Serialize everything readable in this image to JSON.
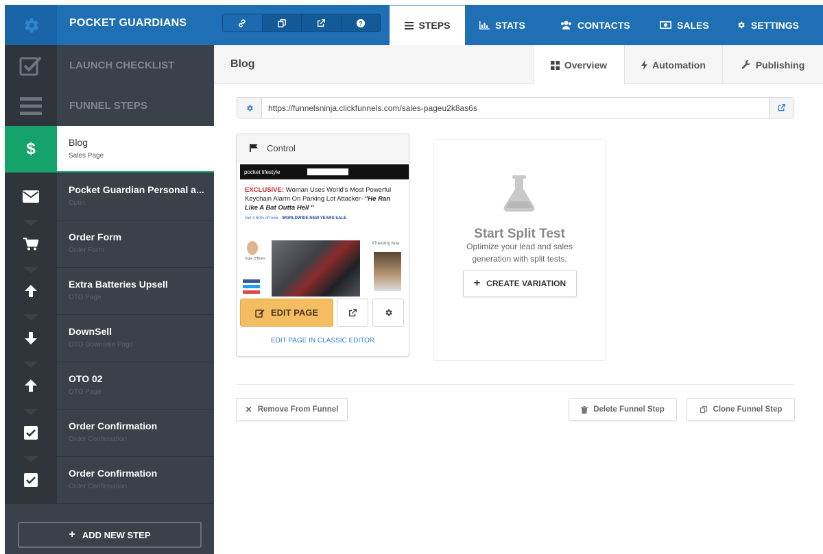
{
  "app": {
    "brand": "POCKET GUARDIANS"
  },
  "topbar": {
    "icons": [
      "link-icon",
      "copy-icon",
      "external-link-icon",
      "help-icon"
    ],
    "tabs": [
      {
        "label": "STEPS",
        "icon": "list-icon",
        "active": true
      },
      {
        "label": "STATS",
        "icon": "bar-chart-icon",
        "active": false
      },
      {
        "label": "CONTACTS",
        "icon": "users-icon",
        "active": false
      },
      {
        "label": "SALES",
        "icon": "money-icon",
        "active": false
      },
      {
        "label": "SETTINGS",
        "icon": "gear-icon",
        "active": false
      }
    ]
  },
  "sidebar": {
    "launch_checklist": "LAUNCH CHECKLIST",
    "funnel_steps": "FUNNEL STEPS",
    "steps": [
      {
        "title": "Blog",
        "subtitle": "Sales Page",
        "icon": "dollar-icon",
        "active": true
      },
      {
        "title": "Pocket Guardian Personal a...",
        "subtitle": "Optin",
        "icon": "envelope-icon",
        "active": false
      },
      {
        "title": "Order Form",
        "subtitle": "Order Form",
        "icon": "cart-icon",
        "active": false
      },
      {
        "title": "Extra Batteries Upsell",
        "subtitle": "OTO Page",
        "icon": "arrow-up-icon",
        "active": false
      },
      {
        "title": "DownSell",
        "subtitle": "OTO Downsale Page",
        "icon": "arrow-down-icon",
        "active": false
      },
      {
        "title": "OTO 02",
        "subtitle": "OTO Page",
        "icon": "arrow-up-icon",
        "active": false
      },
      {
        "title": "Order Confirmation",
        "subtitle": "Order Confirmation",
        "icon": "checkbox-icon",
        "active": false
      },
      {
        "title": "Order Confirmation",
        "subtitle": "Order Confirmation",
        "icon": "checkbox-icon",
        "active": false
      }
    ],
    "add_step": "ADD NEW STEP"
  },
  "main": {
    "page_title": "Blog",
    "tabs": [
      {
        "label": "Overview",
        "icon": "grid-icon",
        "active": true
      },
      {
        "label": "Automation",
        "icon": "bolt-icon",
        "active": false
      },
      {
        "label": "Publishing",
        "icon": "wrench-icon",
        "active": false
      }
    ],
    "url": "https://funnelsninja.clickfunnels.com/sales-pageu2k8as6s",
    "control": {
      "label": "Control",
      "preview": {
        "logo": "pocket lifestyle",
        "headline_red": "EXCLUSIVE:",
        "headline": "Woman Uses World's Most Powerful Keychain Alarm On Parking Lot Attacker-",
        "headline_quote": "\"He Ran Like A Bat Outta Hell \"",
        "promo": "Get it 50% off now - ",
        "promo_bold": "WORLDWIDE NEW YEARS SALE",
        "author": "Kate O'Brien",
        "trending": "#Trending Now"
      },
      "edit_page": "EDIT PAGE",
      "classic_editor": "EDIT PAGE IN CLASSIC EDITOR"
    },
    "split_test": {
      "title": "Start Split Test",
      "description": "Optimize your lead and sales generation with split tests.",
      "button": "CREATE VARIATION"
    },
    "actions": {
      "remove": "Remove From Funnel",
      "delete": "Delete Funnel Step",
      "clone": "Clone Funnel Step"
    }
  },
  "colors": {
    "topbar": "#1f6fb5",
    "sidebar": "#3b4148",
    "active_green": "#16a36b",
    "edit_button": "#f5bd62",
    "link_blue": "#2f7ed8"
  }
}
